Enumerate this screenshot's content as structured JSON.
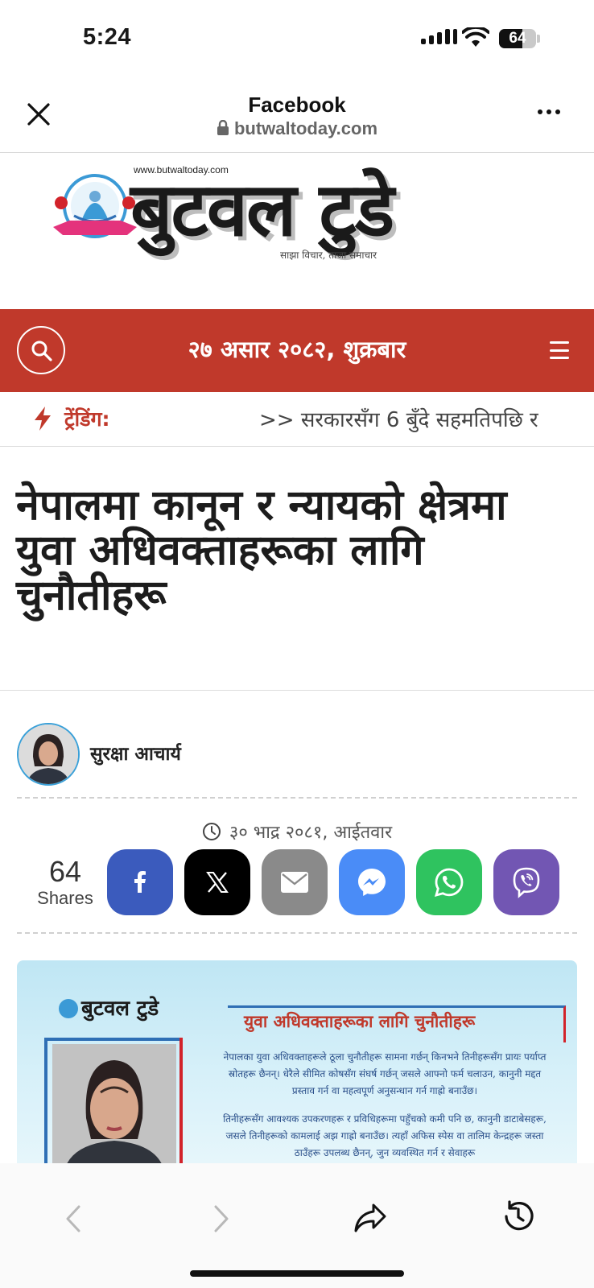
{
  "status_bar": {
    "time": "5:24",
    "battery_percent": 64,
    "battery_label": "64"
  },
  "browser": {
    "title": "Facebook",
    "url": "butwaltoday.com"
  },
  "site": {
    "logo_url": "www.butwaltoday.com",
    "logo_name": "बुटवल टुडे",
    "tagline": "साझा विचार, ताजा समाचार",
    "date": "२७ असार २०८२, शुक्रबार",
    "trending_label": "ट्रेंडिंग:",
    "trending_ticker": ">> सरकारसँग 6 बुँदे सहमतिपछि र"
  },
  "article": {
    "headline": "नेपालमा कानून र न्यायको क्षेत्रमा युवा अधिवक्ताहरूका लागि चुनौतीहरू",
    "author": "सुरक्षा आचार्य",
    "published": "३० भाद्र २०८१, आईतवार",
    "share_count": "64",
    "share_label": "Shares"
  },
  "share_buttons": [
    {
      "name": "facebook",
      "color": "#3b5bbd"
    },
    {
      "name": "x",
      "color": "#000000"
    },
    {
      "name": "email",
      "color": "#8a8a8a"
    },
    {
      "name": "messenger",
      "color": "#4a8cf7"
    },
    {
      "name": "whatsapp",
      "color": "#2fc35f"
    },
    {
      "name": "viber",
      "color": "#7256b3"
    }
  ],
  "article_image": {
    "logo_text": "बुटवल टुडे",
    "title": "युवा अधिवक्ताहरूका लागि चुनौतीहरू",
    "paragraph_1": "नेपालका युवा अधिवक्ताहरूले ठूला चुनौतीहरू सामना गर्छन् किनभने तिनीहरूसँग प्रायः पर्याप्त स्रोतहरू छैनन्। धेरैले सीमित कोषसँग संघर्ष गर्छन् जसले आफ्नो फर्म चलाउन, कानुनी मद्दत प्रस्ताव गर्न वा महत्वपूर्ण अनुसन्धान गर्न गाह्रो बनाउँछ।",
    "paragraph_2": "तिनीहरूसँग आवश्यक उपकरणहरू र प्रविधिहरूमा पहुँचको कमी पनि छ, कानुनी डाटाबेसहरू, जसले तिनीहरूको कामलाई अझ गाह्रो बनाउँछ। त्यहाँ अफिस स्पेस वा तालिम केन्द्रहरू जस्ता ठाउँहरू उपलब्ध छैनन्, जुन व्यवस्थित गर्न र सेवाहरू"
  },
  "colors": {
    "brand_red": "#c0392b",
    "trending_red": "#c0392b",
    "avatar_ring": "#3aa0d8"
  }
}
